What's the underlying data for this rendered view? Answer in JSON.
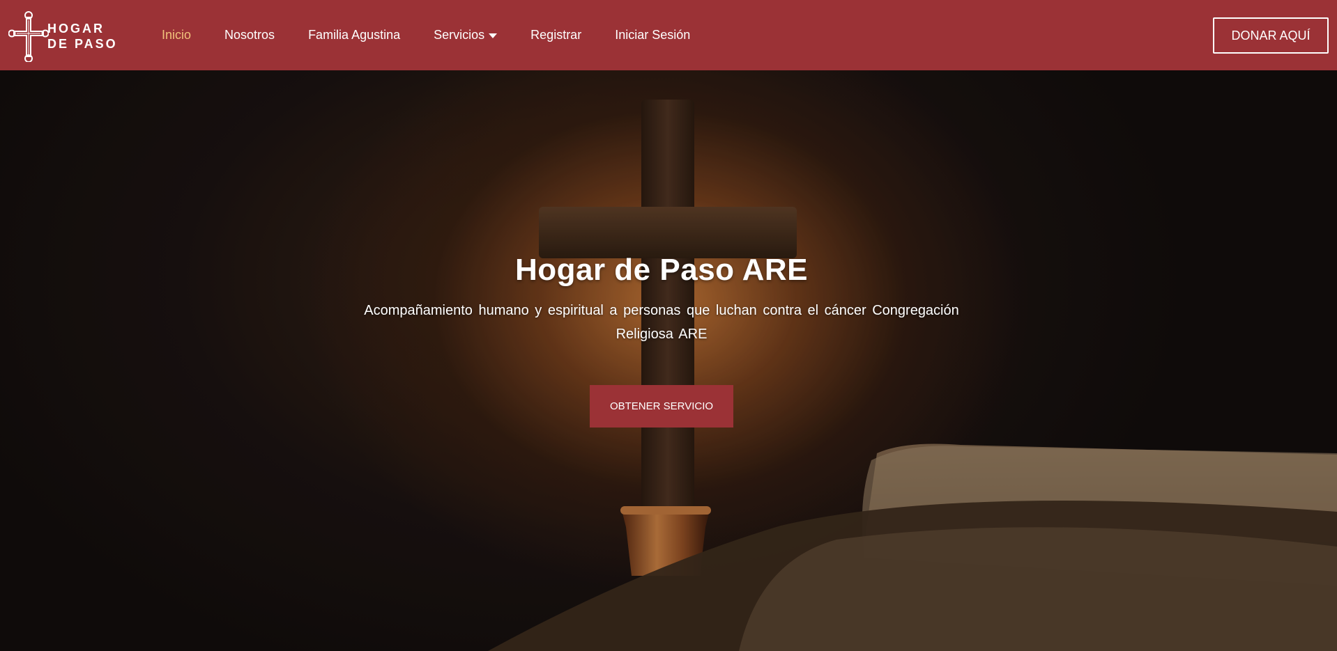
{
  "brand": {
    "line1": "HOGAR",
    "line2": "DE PASO",
    "color": "#9b3236"
  },
  "nav": {
    "items": [
      {
        "label": "Inicio",
        "active": true
      },
      {
        "label": "Nosotros"
      },
      {
        "label": "Familia Agustina"
      },
      {
        "label": "Servicios",
        "dropdown": true
      },
      {
        "label": "Registrar"
      },
      {
        "label": "Iniciar Sesión"
      }
    ],
    "active_color": "#f1c27b",
    "donate_label": "DONAR AQUÍ"
  },
  "hero": {
    "title": "Hogar de Paso ARE",
    "subtitle": "Acompañamiento humano y espiritual a personas que luchan contra el cáncer Congregación Religiosa ARE",
    "cta_label": "OBTENER SERVICIO"
  }
}
